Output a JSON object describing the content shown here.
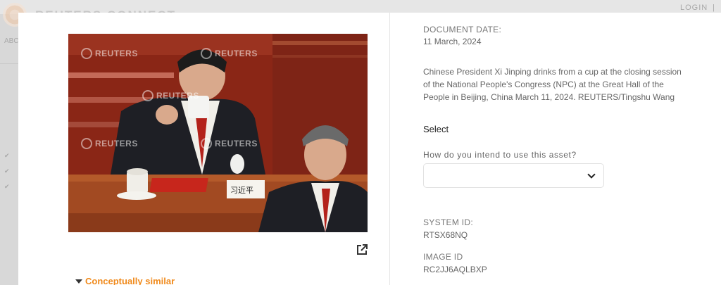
{
  "background_page": {
    "brand": "REUTERS CONNECT",
    "login": "LOGIN",
    "separator": "|",
    "section_abbrev": "ABC",
    "marks": [
      "✔",
      "✔",
      "✔"
    ]
  },
  "photo": {
    "watermark": "REUTERS",
    "nameplate": "习近平"
  },
  "document": {
    "date_label": "DOCUMENT DATE:",
    "date_value": "11 March, 2024",
    "caption": "Chinese President Xi Jinping drinks from a cup at the closing session of the National People's Congress (NPC) at the Great Hall of the People in Beijing, China March 11, 2024. REUTERS/Tingshu Wang",
    "select_title": "Select",
    "select_question": "How do you intend to use this asset?",
    "select_value": "",
    "system_id_label": "SYSTEM ID:",
    "system_id_value": "RTSX68NQ",
    "image_id_label": "IMAGE ID",
    "image_id_value": "RC2JJ6AQLBXP"
  },
  "similar": {
    "label": "Conceptually similar"
  },
  "colors": {
    "accent": "#f08a1c",
    "modal_bg": "#ffffff",
    "overlay_bg": "#d8d8d8"
  },
  "icons": {
    "external_link": "external-link-icon",
    "chevron": "chevron-down-icon",
    "caret": "caret-down-icon"
  }
}
